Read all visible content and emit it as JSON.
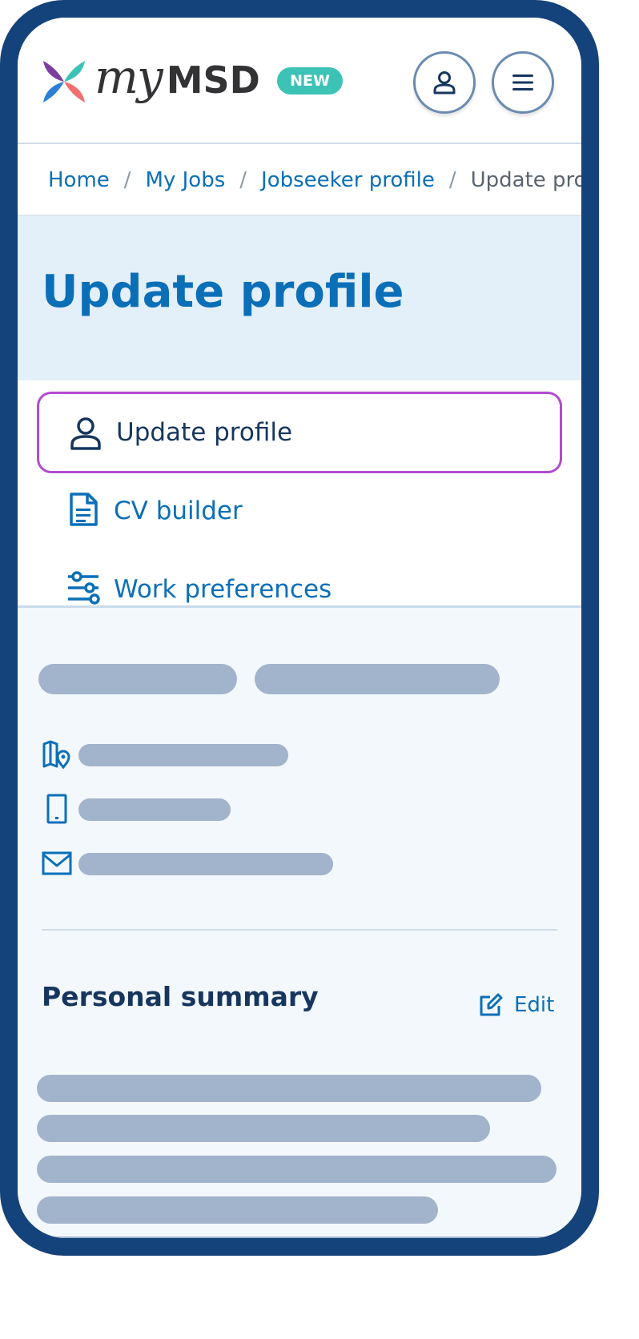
{
  "brand": {
    "logo_word_my": "my",
    "logo_word_msd": "MSD",
    "badge": "NEW",
    "colors": {
      "navy": "#14427a",
      "blue": "#0b6fb8",
      "teal": "#3cc3b6",
      "focus": "#b24bd1",
      "skeleton": "#a2b4cb"
    }
  },
  "header": {
    "profile_icon": "person-icon",
    "menu_icon": "hamburger-icon"
  },
  "breadcrumb": {
    "items": [
      "Home",
      "My Jobs",
      "Jobseeker profile"
    ],
    "current": "Update pro",
    "separator": "/"
  },
  "page": {
    "title": "Update profile"
  },
  "subnav": {
    "items": [
      {
        "label": "Update profile",
        "icon": "person-icon",
        "active": true
      },
      {
        "label": "CV builder",
        "icon": "document-icon",
        "active": false
      },
      {
        "label": "Work preferences",
        "icon": "sliders-icon",
        "active": false
      }
    ]
  },
  "profile": {
    "icons": [
      "map-pin-icon",
      "mobile-phone-icon",
      "mail-icon"
    ],
    "summary_title": "Personal summary",
    "edit_label": "Edit",
    "edit_icon": "edit-icon"
  }
}
